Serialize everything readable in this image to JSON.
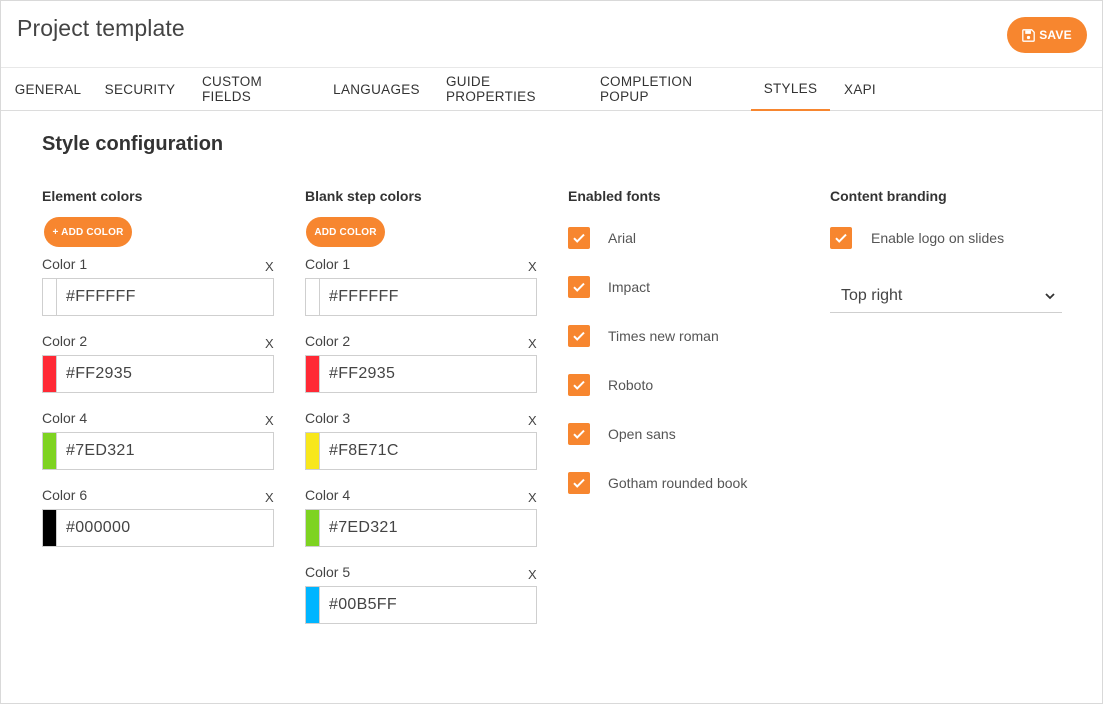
{
  "header": {
    "title": "Project template",
    "save_label": "SAVE",
    "accent": "#f7862f"
  },
  "tabs": [
    {
      "label": "GENERAL"
    },
    {
      "label": "SECURITY"
    },
    {
      "label": "CUSTOM FIELDS"
    },
    {
      "label": "LANGUAGES"
    },
    {
      "label": "GUIDE PROPERTIES"
    },
    {
      "label": "COMPLETION POPUP"
    },
    {
      "label": "STYLES",
      "active": true
    },
    {
      "label": "XAPI"
    }
  ],
  "main": {
    "section_title": "Style configuration",
    "element_colors": {
      "title": "Element colors",
      "add_label": "+ ADD COLOR",
      "items": [
        {
          "label": "Color 1",
          "value": "#FFFFFF",
          "swatch": "#FFFFFF"
        },
        {
          "label": "Color 2",
          "value": "#FF2935",
          "swatch": "#FF2935"
        },
        {
          "label": "Color 4",
          "value": "#7ED321",
          "swatch": "#7ED321"
        },
        {
          "label": "Color 6",
          "value": "#000000",
          "swatch": "#000000"
        }
      ]
    },
    "blank_step_colors": {
      "title": "Blank step colors",
      "add_label": "ADD COLOR",
      "items": [
        {
          "label": "Color 1",
          "value": "#FFFFFF",
          "swatch": "#FFFFFF"
        },
        {
          "label": "Color 2",
          "value": "#FF2935",
          "swatch": "#FF2935"
        },
        {
          "label": "Color 3",
          "value": "#F8E71C",
          "swatch": "#F8E71C"
        },
        {
          "label": "Color 4",
          "value": "#7ED321",
          "swatch": "#7ED321"
        },
        {
          "label": "Color 5",
          "value": "#00B5FF",
          "swatch": "#00B5FF"
        }
      ]
    },
    "remove_label": "X",
    "enabled_fonts": {
      "title": "Enabled fonts",
      "items": [
        {
          "label": "Arial",
          "checked": true
        },
        {
          "label": "Impact",
          "checked": true
        },
        {
          "label": "Times new roman",
          "checked": true
        },
        {
          "label": "Roboto",
          "checked": true
        },
        {
          "label": "Open sans",
          "checked": true
        },
        {
          "label": "Gotham rounded book",
          "checked": true
        }
      ]
    },
    "content_branding": {
      "title": "Content branding",
      "logo_label": "Enable logo on slides",
      "logo_checked": true,
      "position_value": "Top right"
    }
  }
}
